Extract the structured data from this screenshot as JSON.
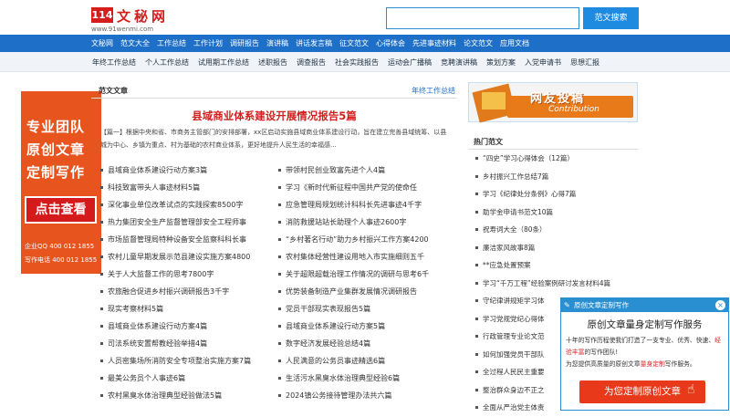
{
  "logo": {
    "badge": "114",
    "name": "文秘网",
    "url": "www.91wenmi.com"
  },
  "search": {
    "placeholder": "",
    "button": "范文搜索"
  },
  "nav_main": [
    "文秘网",
    "范文大全",
    "工作总结",
    "工作计划",
    "调研报告",
    "演讲稿",
    "讲话发言稿",
    "征文范文",
    "心得体会",
    "先进事迹材料",
    "论文范文",
    "应用文档"
  ],
  "nav_sub": [
    "年终工作总结",
    "个人工作总结",
    "试用期工作总结",
    "述职报告",
    "调查报告",
    "社会实践报告",
    "运动会广播稿",
    "竞聘演讲稿",
    "策划方案",
    "入党申请书",
    "思想汇报"
  ],
  "left_ad": {
    "line1": "专业团队",
    "line2": "原创文章",
    "line3": "定制写作",
    "button": "点击查看",
    "qq": "企业QQ  400 012 1855",
    "phone": "写作电话 400 012 1855"
  },
  "main": {
    "section": "范文文章",
    "more": "年终工作总结",
    "feature_title": "县域商业体系建设开展情况报告5篇",
    "feature_tag": "【篇一】",
    "feature_summary": "根据中央和省、市商务主管部门的安排部署，xx区启动实施县域商业体系建设行动，旨在建立完善县域统筹、以县城为中心、乡镇为重点、村为基础的农村商业体系，更好地提升人民生活的幸福感...",
    "col1": [
      "县域商业体系建设行动方案3篇",
      "科技致富带头人事迹材料5篇",
      "深化事业单位改革试点的实践探索8500字",
      "热力集团安全生产监督管理部安全工程师事",
      "市场监督管理局特种设备安全监察科科长事",
      "农村儿童早期发展示范县建设实施方案4800",
      "关于人大监督工作的思考7800字",
      "农旅融合促进乡村振兴调研报告3千字",
      "现实考察材料5篇",
      "县域商业体系建设行动方案4篇",
      "司法系统安置帮教经验举措4篇",
      "人员密集场所消防安全专项整治实施方案7篇",
      "最美公务员个人事迹6篇",
      "农村黑臭水体治理典型经验做法5篇"
    ],
    "col2": [
      "带领村民创业致富先进个人4篇",
      "学习《新时代新征程中国共产党的使命任",
      "应急管理局规划统计科科长先进事迹4千字",
      "消防救援站站长助理个人事迹2600字",
      "“乡村著名行动”助力乡村振兴工作方案4200",
      "农村集体经营性建设用地入市实施细则五千",
      "关于超限超载治理工作情况的调研与思考6千",
      "优势装备制造产业集群发展情况调研报告",
      "党员干部现实表现报告5篇",
      "县域商业体系建设行动方案5篇",
      "数字经济发展经验总结4篇",
      "人民满意的公务员事迹精选6篇",
      "生活污水黑臭水体治理典型经验6篇",
      "2024镇公务接待管理办法共六篇"
    ]
  },
  "submit": {
    "title": "网友投稿",
    "subtitle": "Contribution"
  },
  "hot": {
    "title": "热门范文",
    "items": [
      "“四史”学习心得体会（12篇）",
      "乡村振兴工作总结7篇",
      "学习《纪律处分条例》心得7篇",
      "助学金申请书范文10篇",
      "祝寿词大全（80条）",
      "廉洁家风故事8篇",
      "**应急处置预案",
      "学习“千万工程”经验案例研讨发言材料4篇",
      "守纪律讲规矩学习体",
      "学习党规党纪心得体",
      "行政管理专业论文范",
      "如何加强党员干部队",
      "全过程人民民主重要",
      "整治群众身边不正之",
      "全面从严治党主体责"
    ]
  },
  "popup": {
    "bar_title": "原创文章定制写作",
    "close": "×",
    "heading": "原创文章量身定制写作服务",
    "desc_a": "十年的写作历程使我们打造了一支专业、优秀、快速、",
    "desc_red": "经验丰富",
    "desc_b": "的写作团队!",
    "desc_c": "为您提供高质量的原创文章",
    "desc_red2": "量身定制",
    "desc_d": "写作服务。",
    "cta": "为您定制原创文章"
  }
}
